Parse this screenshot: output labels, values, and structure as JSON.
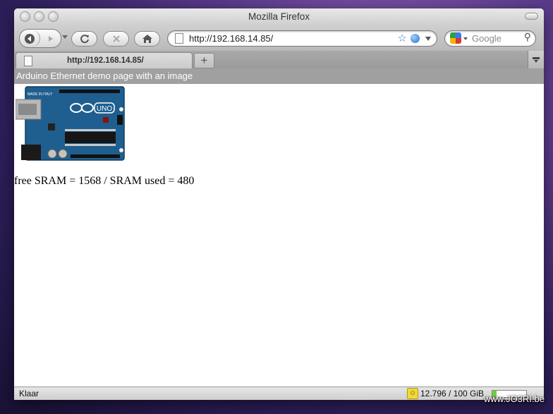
{
  "window": {
    "title": "Mozilla Firefox"
  },
  "toolbar": {
    "url": "http://192.168.14.85/",
    "search_placeholder": "Google"
  },
  "tabs": [
    {
      "label": "http://192.168.14.85/"
    }
  ],
  "new_tab_label": "+",
  "page": {
    "banner": "Arduino Ethernet demo page with an image",
    "sram_text": "free SRAM = 1568 / SRAM used = 480",
    "board_text": {
      "logo": "UNO",
      "made_in": "MADE IN ITALY"
    }
  },
  "statusbar": {
    "status": "Klaar",
    "quota": "12.796 / 100 GiB",
    "quota_fraction": 0.128
  },
  "watermark": "www.JO3RI.be"
}
